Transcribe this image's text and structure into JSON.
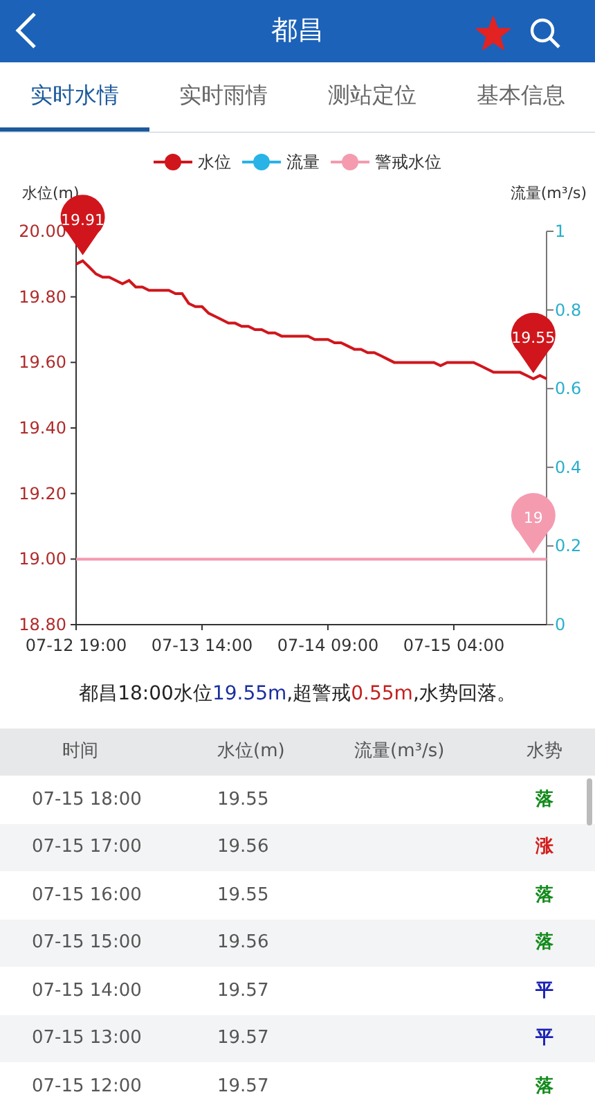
{
  "header": {
    "title": "都昌",
    "favorite": true
  },
  "tabs": [
    {
      "label": "实时水情",
      "selected": true
    },
    {
      "label": "实时雨情",
      "selected": false
    },
    {
      "label": "测站定位",
      "selected": false
    },
    {
      "label": "基本信息",
      "selected": false
    }
  ],
  "chart_data": {
    "type": "line",
    "ylabel": "水位(m)",
    "y2label": "流量(m³/s)",
    "categories": [
      "07-12 19:00",
      null,
      null,
      null,
      null,
      null,
      null,
      null,
      null,
      null,
      null,
      null,
      null,
      null,
      null,
      null,
      null,
      null,
      null,
      "07-13 14:00",
      null,
      null,
      null,
      null,
      null,
      null,
      null,
      null,
      null,
      null,
      null,
      null,
      null,
      null,
      null,
      null,
      null,
      null,
      "07-14 09:00",
      null,
      null,
      null,
      null,
      null,
      null,
      null,
      null,
      null,
      null,
      null,
      null,
      null,
      null,
      null,
      null,
      null,
      null,
      "07-15 04:00",
      null,
      null,
      null,
      null,
      null,
      null,
      null,
      null,
      null,
      null,
      null,
      null,
      null,
      null
    ],
    "ylim": [
      18.8,
      20.0
    ],
    "yticks": [
      {
        "value": 18.8,
        "label": "18.80"
      },
      {
        "value": 19.0,
        "label": "19.00"
      },
      {
        "value": 19.2,
        "label": "19.20"
      },
      {
        "value": 19.4,
        "label": "19.40"
      },
      {
        "value": 19.6,
        "label": "19.60"
      },
      {
        "value": 19.8,
        "label": "19.80"
      },
      {
        "value": 20.0,
        "label": "20.00"
      }
    ],
    "y2lim": [
      0,
      1
    ],
    "y2ticks": [
      {
        "value": 0,
        "label": "0"
      },
      {
        "value": 0.2,
        "label": "0.2"
      },
      {
        "value": 0.4,
        "label": "0.4"
      },
      {
        "value": 0.6,
        "label": "0.6"
      },
      {
        "value": 0.8,
        "label": "0.8"
      },
      {
        "value": 1,
        "label": "1"
      }
    ],
    "series": [
      {
        "name": "水位",
        "color": "#d0161c",
        "values": [
          19.9,
          19.91,
          19.89,
          19.87,
          19.86,
          19.86,
          19.85,
          19.84,
          19.85,
          19.83,
          19.83,
          19.82,
          19.82,
          19.82,
          19.82,
          19.81,
          19.81,
          19.78,
          19.77,
          19.77,
          19.75,
          19.74,
          19.73,
          19.72,
          19.72,
          19.71,
          19.71,
          19.7,
          19.7,
          19.69,
          19.69,
          19.68,
          19.68,
          19.68,
          19.68,
          19.68,
          19.67,
          19.67,
          19.67,
          19.66,
          19.66,
          19.65,
          19.64,
          19.64,
          19.63,
          19.63,
          19.62,
          19.61,
          19.6,
          19.6,
          19.6,
          19.6,
          19.6,
          19.6,
          19.6,
          19.59,
          19.6,
          19.6,
          19.6,
          19.6,
          19.6,
          19.59,
          19.58,
          19.57,
          19.57,
          19.57,
          19.57,
          19.57,
          19.56,
          19.55,
          19.56,
          19.55
        ]
      },
      {
        "name": "流量",
        "color": "#29b3e6",
        "values": [
          null,
          null,
          null,
          null,
          null,
          null,
          null,
          null,
          null,
          null,
          null,
          null,
          null,
          null,
          null,
          null,
          null,
          null,
          null,
          null,
          null,
          null,
          null,
          null,
          null,
          null,
          null,
          null,
          null,
          null,
          null,
          null,
          null,
          null,
          null,
          null,
          null,
          null,
          null,
          null,
          null,
          null,
          null,
          null,
          null,
          null,
          null,
          null,
          null,
          null,
          null,
          null,
          null,
          null,
          null,
          null,
          null,
          null,
          null,
          null,
          null,
          null,
          null,
          null,
          null,
          null,
          null,
          null,
          null,
          null,
          null,
          null
        ]
      },
      {
        "name": "警戒水位",
        "color": "#f49bb0",
        "values": [
          19.0,
          19.0,
          19.0,
          19.0,
          19.0,
          19.0,
          19.0,
          19.0,
          19.0,
          19.0,
          19.0,
          19.0,
          19.0,
          19.0,
          19.0,
          19.0,
          19.0,
          19.0,
          19.0,
          19.0,
          19.0,
          19.0,
          19.0,
          19.0,
          19.0,
          19.0,
          19.0,
          19.0,
          19.0,
          19.0,
          19.0,
          19.0,
          19.0,
          19.0,
          19.0,
          19.0,
          19.0,
          19.0,
          19.0,
          19.0,
          19.0,
          19.0,
          19.0,
          19.0,
          19.0,
          19.0,
          19.0,
          19.0,
          19.0,
          19.0,
          19.0,
          19.0,
          19.0,
          19.0,
          19.0,
          19.0,
          19.0,
          19.0,
          19.0,
          19.0,
          19.0,
          19.0,
          19.0,
          19.0,
          19.0,
          19.0,
          19.0,
          19.0,
          19.0,
          19.0,
          19.0,
          19.0
        ]
      }
    ],
    "annotations": [
      {
        "text": "19.91",
        "y": 19.91
      },
      {
        "text": "19.55",
        "y": 19.55
      },
      {
        "text": "19",
        "y": 19.0
      }
    ]
  },
  "summary": [
    {
      "text": "都昌18:00水位",
      "kind": "plain"
    },
    {
      "text": "19.55m",
      "kind": "level"
    },
    {
      "text": ",超警戒",
      "kind": "plain"
    },
    {
      "text": "0.55m",
      "kind": "excess"
    },
    {
      "text": ",水势回落。",
      "kind": "plain"
    }
  ],
  "table": {
    "columns": [
      "时间",
      "水位(m)",
      "流量(m³/s)",
      "水势"
    ],
    "rows": [
      {
        "time": "07-15 18:00",
        "level": "19.55",
        "trend": "落",
        "kind": "fall"
      },
      {
        "time": "07-15 17:00",
        "level": "19.56",
        "trend": "涨",
        "kind": "rise"
      },
      {
        "time": "07-15 16:00",
        "level": "19.55",
        "trend": "落",
        "kind": "fall"
      },
      {
        "time": "07-15 15:00",
        "level": "19.56",
        "trend": "落",
        "kind": "fall"
      },
      {
        "time": "07-15 14:00",
        "level": "19.57",
        "trend": "平",
        "kind": "flat"
      },
      {
        "time": "07-15 13:00",
        "level": "19.57",
        "trend": "平",
        "kind": "flat"
      },
      {
        "time": "07-15 12:00",
        "level": "19.57",
        "trend": "落",
        "kind": "fall"
      }
    ]
  }
}
